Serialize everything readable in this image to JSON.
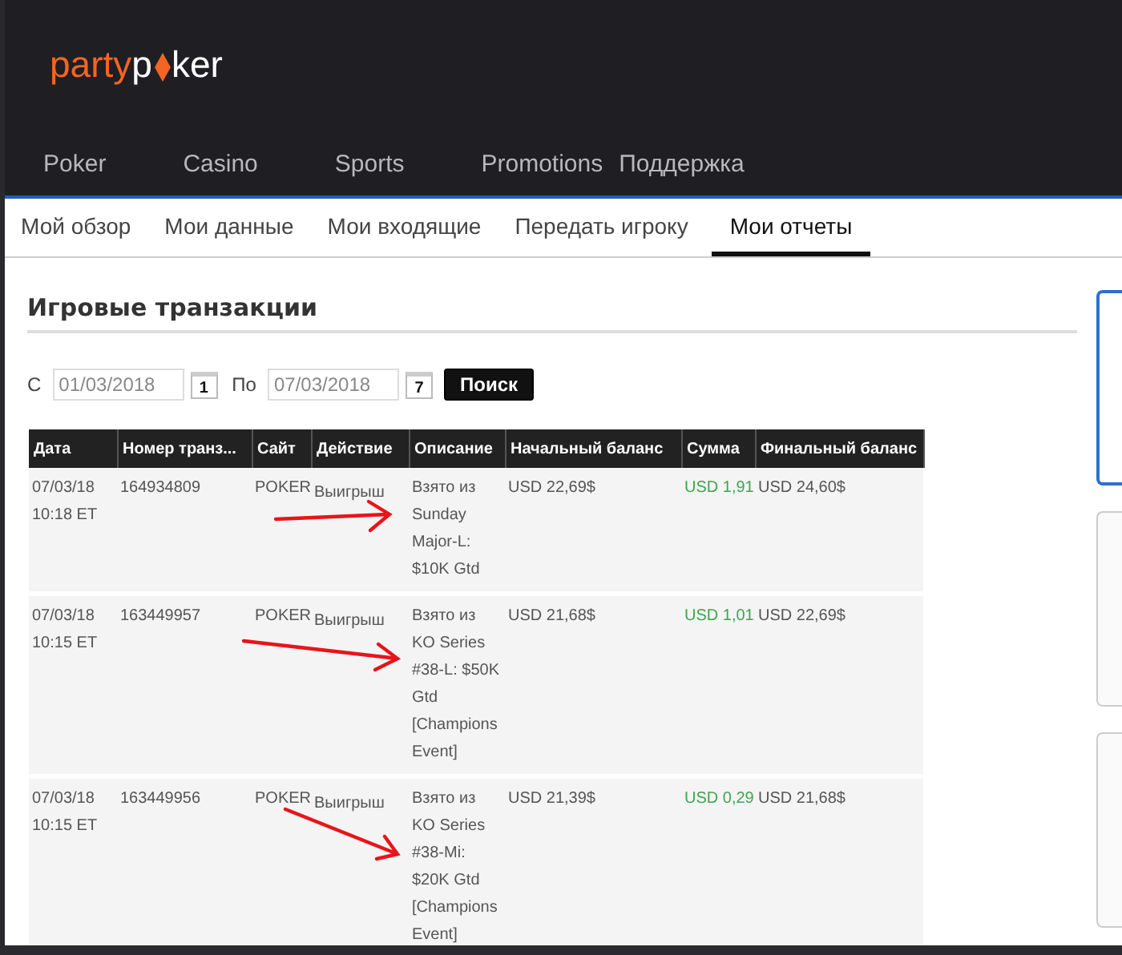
{
  "logo": {
    "part1": "party",
    "part2": "p",
    "part3": "ker"
  },
  "nav": [
    "Poker",
    "Casino",
    "Sports",
    "Promotions",
    "Поддержка"
  ],
  "subnav": [
    {
      "label": "Мой обзор",
      "selected": false
    },
    {
      "label": "Мои данные",
      "selected": false
    },
    {
      "label": "Мои входящие",
      "selected": false
    },
    {
      "label": "Передать игроку",
      "selected": false
    },
    {
      "label": "Мои отчеты",
      "selected": true
    }
  ],
  "section_title": "Игровые транзакции",
  "filter": {
    "from_label": "С",
    "from_value": "01/03/2018",
    "from_day": "1",
    "to_label": "По",
    "to_value": "07/03/2018",
    "to_day": "7",
    "search_button": "Поиск"
  },
  "table": {
    "columns": [
      "Дата",
      "Номер транз...",
      "Сайт",
      "Действие",
      "Описание",
      "Начальный баланс",
      "Сумма",
      "Финальный баланс"
    ],
    "rows": [
      {
        "date": [
          "07/03/18",
          "10:18 ET"
        ],
        "number": "164934809",
        "site": "POKER",
        "action": "Выигрыш",
        "description": [
          "Взято из",
          "Sunday",
          "Major-L:",
          "$10K Gtd"
        ],
        "start": "USD 22,69$",
        "amount": "USD 1,91",
        "final": "USD 24,60$"
      },
      {
        "date": [
          "07/03/18",
          "10:15 ET"
        ],
        "number": "163449957",
        "site": "POKER",
        "action": "Выигрыш",
        "description": [
          "Взято из",
          "KO Series",
          "#38-L: $50K",
          "Gtd",
          "[Champions",
          "Event]"
        ],
        "start": "USD 21,68$",
        "amount": "USD 1,01",
        "final": "USD 22,69$"
      },
      {
        "date": [
          "07/03/18",
          "10:15 ET"
        ],
        "number": "163449956",
        "site": "POKER",
        "action": "Выигрыш",
        "description": [
          "Взято из",
          "KO Series",
          "#38-Mi:",
          "$20K Gtd",
          "[Champions",
          "Event]"
        ],
        "start": "USD 21,39$",
        "amount": "USD 0,29",
        "final": "USD 21,68$"
      }
    ]
  }
}
